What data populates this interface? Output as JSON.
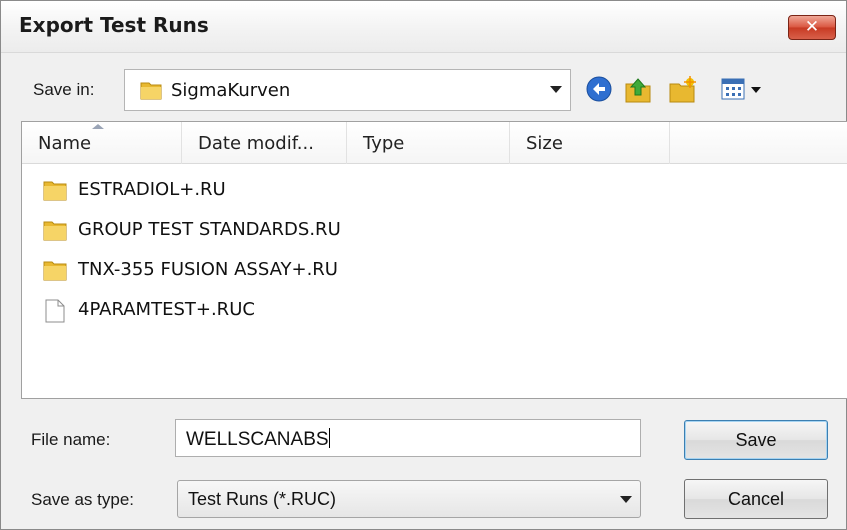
{
  "window": {
    "title": "Export Test Runs",
    "close_glyph": "✕"
  },
  "save_in": {
    "label": "Save in:",
    "current_folder": "SigmaKurven"
  },
  "toolbar": {
    "icons": [
      "back-icon",
      "up-folder-icon",
      "new-folder-icon",
      "views-menu-icon"
    ]
  },
  "list": {
    "columns": [
      "Name",
      "Date modif...",
      "Type",
      "Size"
    ],
    "items": [
      {
        "name": "ESTRADIOL+.RU",
        "kind": "folder"
      },
      {
        "name": "GROUP TEST STANDARDS.RU",
        "kind": "folder"
      },
      {
        "name": "TNX-355 FUSION ASSAY+.RU",
        "kind": "folder"
      },
      {
        "name": "4PARAMTEST+.RUC",
        "kind": "file"
      }
    ]
  },
  "file_name": {
    "label": "File name:",
    "value": "WELLSCANABS"
  },
  "save_as_type": {
    "label": "Save as type:",
    "value": "Test Runs (*.RUC)"
  },
  "buttons": {
    "save": "Save",
    "cancel": "Cancel"
  },
  "colors": {
    "close_red": "#c73a23",
    "back_blue": "#2f6fd0",
    "folder_yellow": "#e8b830"
  }
}
